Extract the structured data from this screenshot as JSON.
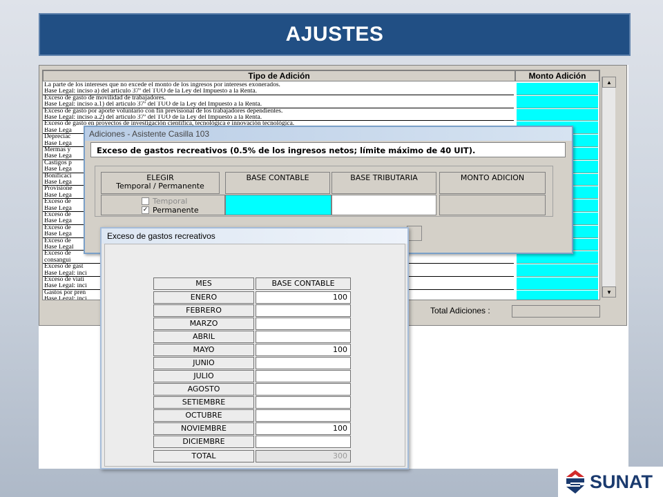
{
  "slide": {
    "title": "AJUSTES",
    "logo_text": "SUNAT"
  },
  "main_table": {
    "col_type": "Tipo de Adición",
    "col_amount": "Monto Adición",
    "rows": [
      "La parte de los intereses que no excede el monto de los ingresos por intereses exonerados.",
      "Base Legal: inciso a) del artículo 37º del TUO de la Ley del Impuesto a la Renta.",
      "Exceso de gasto de movilidad de trabajadores.",
      "Base Legal: inciso a.1) del artículo 37º del TUO de la Ley del Impuesto a la Renta.",
      "Exceso de gasto por aporte voluntario con fin previsional de los trabajadores dependientes.",
      "Base Legal: inciso a.2) del artículo 37º del TUO de la Ley del Impuesto a la Renta.",
      "Exceso de gasto en proyectos de investigación científica, tecnológica e innovación tecnológica.",
      "Base Lega",
      "Depreciac",
      "Base Lega",
      "Mermas y",
      "Base Lega",
      "Castigos p",
      "Base Lega",
      "Bonificaci",
      "Base Lega",
      "Provisione",
      "Base Lega",
      "Exceso de",
      "Base Lega",
      "Exceso de",
      "Base Lega",
      "Exceso de",
      "Base Lega",
      "Exceso de",
      "Base Legal",
      "Exceso de",
      "consangui",
      "Exceso de gast",
      "Base Legal: inci",
      "Exceso de viati",
      "Base Legal: inci",
      "Gastos por pren",
      "Base Legal: inci"
    ],
    "total_label": "Total Adiciones :"
  },
  "dialog_adiciones": {
    "title": "Adiciones - Asistente Casilla 103",
    "heading": "Exceso de gastos recreativos (0.5% de los ingresos netos; límite máximo de 40 UIT).",
    "col_elegir_1": "ELEGIR",
    "col_elegir_2": "Temporal / Permanente",
    "col_base_contable": "BASE CONTABLE",
    "col_base_tributaria": "BASE TRIBUTARIA",
    "col_monto_adicion": "MONTO ADICION",
    "opt_temporal": "Temporal",
    "opt_permanente": "Permanente",
    "permanente_checked": true
  },
  "dialog_gastos": {
    "title": "Exceso de gastos recreativos",
    "col_mes": "MES",
    "col_base": "BASE CONTABLE",
    "months": [
      {
        "mes": "ENERO",
        "valor": "100"
      },
      {
        "mes": "FEBRERO",
        "valor": ""
      },
      {
        "mes": "MARZO",
        "valor": ""
      },
      {
        "mes": "ABRIL",
        "valor": ""
      },
      {
        "mes": "MAYO",
        "valor": "100"
      },
      {
        "mes": "JUNIO",
        "valor": ""
      },
      {
        "mes": "JULIO",
        "valor": ""
      },
      {
        "mes": "AGOSTO",
        "valor": ""
      },
      {
        "mes": "SETIEMBRE",
        "valor": ""
      },
      {
        "mes": "OCTUBRE",
        "valor": ""
      },
      {
        "mes": "NOVIEMBRE",
        "valor": "100"
      },
      {
        "mes": "DICIEMBRE",
        "valor": ""
      }
    ],
    "total_label": "TOTAL",
    "total_value": "300"
  },
  "colors": {
    "title_bg": "#214f84",
    "cyan_cell": "#00ffff",
    "logo_red": "#d22b2b",
    "logo_blue": "#1a3a6e"
  }
}
